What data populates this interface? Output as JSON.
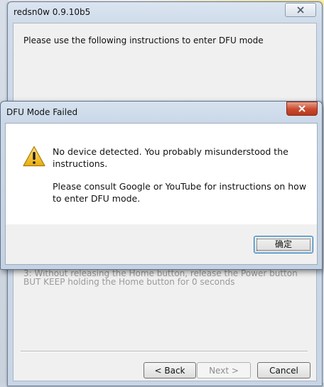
{
  "main_window": {
    "title": "redsn0w 0.9.10b5",
    "instruction": "Please use the following instructions to enter DFU mode",
    "step_line1": "3: Without releasing the Home button, release the Power button",
    "step_line2": "BUT KEEP holding the Home button for 0 seconds",
    "buttons": {
      "back": "< Back",
      "next": "Next >",
      "cancel": "Cancel"
    }
  },
  "dialog": {
    "title": "DFU Mode Failed",
    "message": {
      "line1": "No device detected. You probably misunderstood the",
      "line2": "instructions.",
      "line3": "Please consult Google or YouTube for instructions on how",
      "line4": "to enter DFU mode."
    },
    "ok_label": "确定",
    "icon": "warning-icon",
    "close_icon": "close-icon"
  },
  "colors": {
    "warning_yellow": "#f3c21b",
    "close_red": "#c94a2e",
    "focus_blue": "#3c7fb1"
  }
}
